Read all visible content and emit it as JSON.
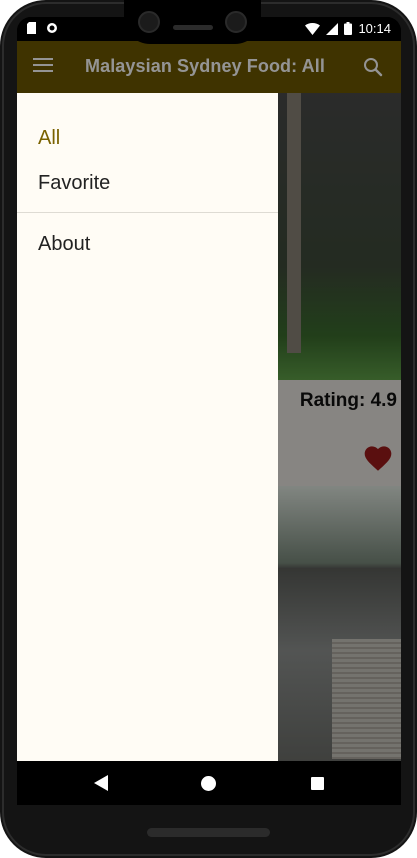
{
  "status_bar": {
    "time": "10:14",
    "left_icons": [
      "sim-card-icon",
      "notification-dot-icon"
    ],
    "right_icons": [
      "wifi-icon",
      "signal-icon",
      "battery-icon"
    ]
  },
  "app_bar": {
    "title": "Malaysian Sydney Food: All",
    "color": "#6d5800",
    "left_icon": "menu-icon",
    "right_icon": "search-icon"
  },
  "drawer": {
    "items": [
      {
        "label": "All",
        "active": true
      },
      {
        "label": "Favorite",
        "active": false
      },
      {
        "label": "About",
        "active": false
      }
    ],
    "active_color": "#7a6200"
  },
  "content": {
    "cards": [
      {
        "rating_text": "Rating: 4.9",
        "favorite": true,
        "favorite_icon": "heart-icon",
        "favorite_color": "#9b1b1b"
      }
    ]
  },
  "nav_bar": {
    "icons": [
      "back-icon",
      "home-icon",
      "recents-icon"
    ]
  }
}
